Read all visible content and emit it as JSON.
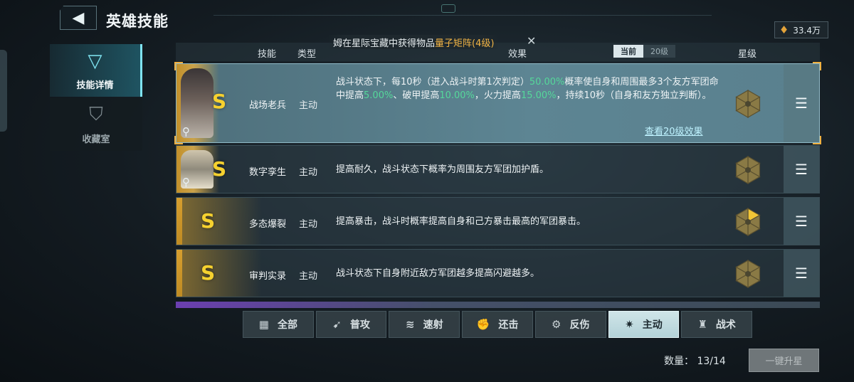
{
  "page": {
    "title": "英雄技能"
  },
  "currency": {
    "value": "33.4万",
    "icon": "fuel-icon"
  },
  "leftnav": {
    "items": [
      {
        "label": "技能详情",
        "icon": "v-emblem-icon",
        "active": true
      },
      {
        "label": "收藏室",
        "icon": "shield-icon",
        "active": false
      }
    ]
  },
  "header": {
    "skill": "技能",
    "type": "类型",
    "effect": "效果",
    "star": "星级",
    "toggle_current": "当前",
    "toggle_level": "20级"
  },
  "ticker": {
    "prefix": "姆在星际宝藏中获得物品",
    "item": "量子矩阵(4级)"
  },
  "skills": [
    {
      "grade": "S",
      "name": "战场老兵",
      "type": "主动",
      "desc_parts": [
        "战斗状态下，每10秒（进入战斗时第1次判定）",
        "50.00%",
        "概率使自身和周围最多3个友方军团命中提高",
        "5.00%",
        "、破甲提高",
        "10.00%",
        "，火力提高",
        "15.00%",
        "，持续10秒（自身和友方独立判断）。"
      ],
      "link": "查看20级效果",
      "stars_filled": 0
    },
    {
      "grade": "S",
      "name": "数字孪生",
      "type": "主动",
      "desc": "提高耐久，战斗状态下概率为周围友方军团加护盾。",
      "stars_filled": 0
    },
    {
      "grade": "S",
      "name": "多态爆裂",
      "type": "主动",
      "desc": "提高暴击，战斗时概率提高自身和己方暴击最高的军团暴击。",
      "stars_filled": 1
    },
    {
      "grade": "S",
      "name": "审判实录",
      "type": "主动",
      "desc": "战斗状态下自身附近敌方军团越多提高闪避越多。",
      "stars_filled": 0
    }
  ],
  "tabs": [
    {
      "label": "全部",
      "icon": "grid-icon"
    },
    {
      "label": "普攻",
      "icon": "bullet-icon"
    },
    {
      "label": "速射",
      "icon": "rapid-fire-icon"
    },
    {
      "label": "还击",
      "icon": "fist-icon"
    },
    {
      "label": "反伤",
      "icon": "gear-icon"
    },
    {
      "label": "主动",
      "icon": "burst-icon",
      "active": true
    },
    {
      "label": "战术",
      "icon": "tactics-icon"
    }
  ],
  "footer": {
    "count_label": "数量：",
    "count_value": "13/14",
    "upgrade_label": "一键升星"
  },
  "colors": {
    "accent": "#7fe3f0",
    "gold": "#f6d12f",
    "highlight": "#55d89a",
    "link": "#bff3ff"
  }
}
